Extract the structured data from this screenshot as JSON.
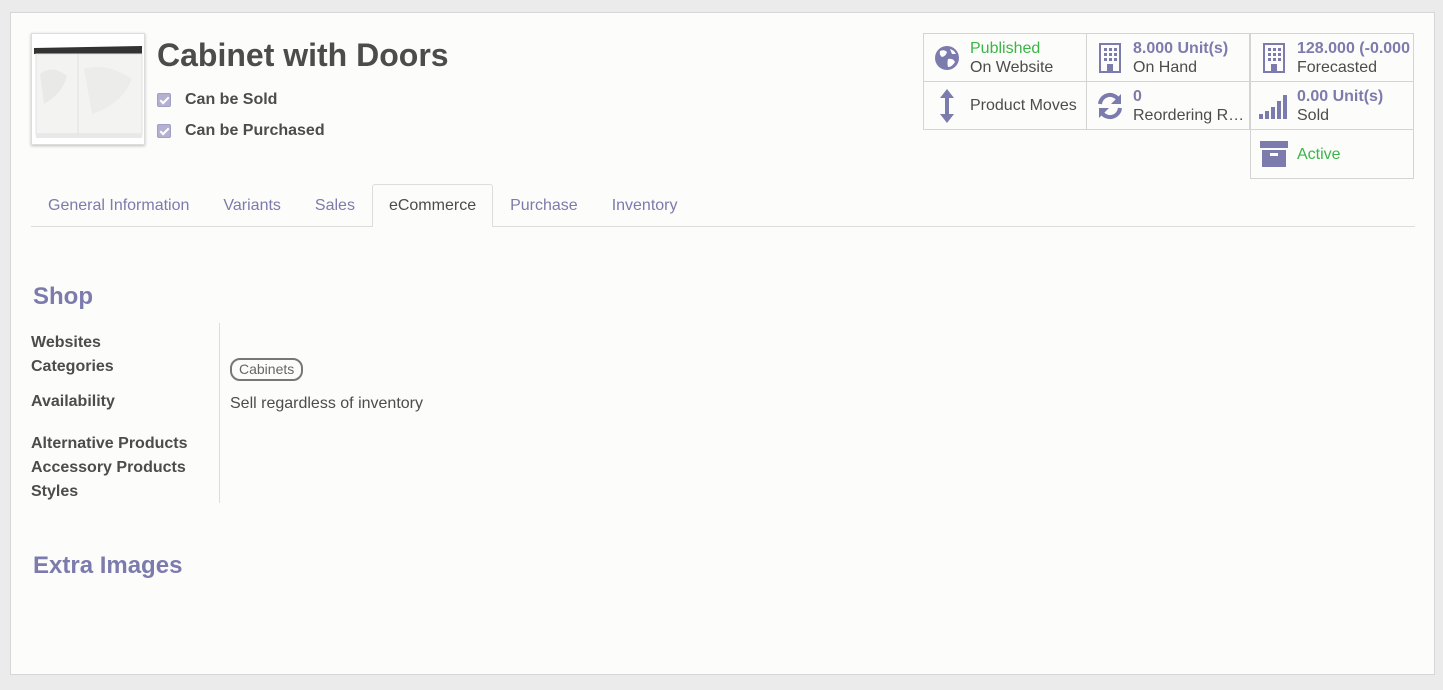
{
  "product": {
    "name": "Cabinet with Doors",
    "can_be_sold": "Can be Sold",
    "can_be_purchased": "Can be Purchased"
  },
  "smart_buttons": {
    "published": {
      "value": "Published",
      "label": "On Website",
      "icon": "globe-icon"
    },
    "on_hand": {
      "value": "8.000 Unit(s)",
      "label": "On Hand",
      "icon": "building-icon"
    },
    "forecasted": {
      "value": "128.000 (-0.000",
      "label": "Forecasted",
      "icon": "building-icon"
    },
    "product_moves": {
      "label": "Product Moves",
      "icon": "arrows-vertical-icon"
    },
    "reordering": {
      "value": "0",
      "label": "Reordering R…",
      "icon": "refresh-icon"
    },
    "sold": {
      "value": "0.00 Unit(s)",
      "label": "Sold",
      "icon": "signal-icon"
    },
    "active": {
      "label": "Active",
      "icon": "archive-icon"
    }
  },
  "tabs": [
    {
      "label": "General Information"
    },
    {
      "label": "Variants"
    },
    {
      "label": "Sales"
    },
    {
      "label": "eCommerce",
      "active": true
    },
    {
      "label": "Purchase"
    },
    {
      "label": "Inventory"
    }
  ],
  "shop": {
    "title": "Shop",
    "websites_label": "Websites",
    "categories_label": "Categories",
    "category_tag": "Cabinets",
    "availability_label": "Availability",
    "availability_value": "Sell regardless of inventory",
    "alternative_label": "Alternative Products",
    "accessory_label": "Accessory Products",
    "styles_label": "Styles"
  },
  "extra_images": {
    "title": "Extra Images"
  },
  "colors": {
    "accent": "#7c7bad",
    "green": "#3cb548",
    "text": "#4c4c4c"
  }
}
